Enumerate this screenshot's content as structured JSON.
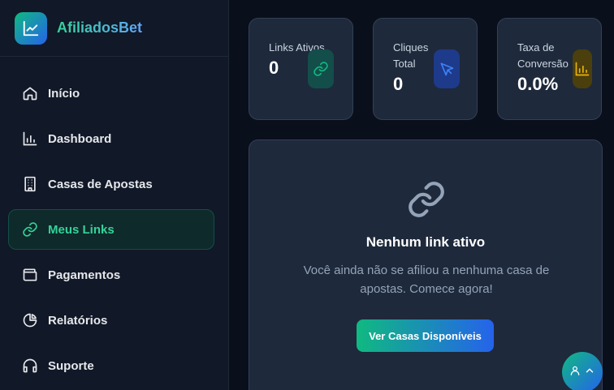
{
  "brand": {
    "name": "AfiliadosBet"
  },
  "sidebar": {
    "items": [
      {
        "label": "Início",
        "icon": "home-icon"
      },
      {
        "label": "Dashboard",
        "icon": "bar-chart-icon"
      },
      {
        "label": "Casas de Apostas",
        "icon": "building-icon"
      },
      {
        "label": "Meus Links",
        "icon": "link-icon",
        "active": true
      },
      {
        "label": "Pagamentos",
        "icon": "wallet-icon"
      },
      {
        "label": "Relatórios",
        "icon": "pie-chart-icon"
      },
      {
        "label": "Suporte",
        "icon": "headphones-icon"
      }
    ]
  },
  "stats": [
    {
      "label": "Links Ativos",
      "value": "0",
      "icon": "link-icon",
      "accent": "#10b981"
    },
    {
      "label": "Cliques Total",
      "value": "0",
      "icon": "cursor-icon",
      "accent": "#3b82f6"
    },
    {
      "label": "Taxa de Conversão",
      "value": "0.0%",
      "icon": "bar-chart-icon",
      "accent": "#eab308"
    }
  ],
  "empty_state": {
    "title": "Nenhum link ativo",
    "description": "Você ainda não se afiliou a nenhuma casa de apostas. Comece agora!",
    "button_label": "Ver Casas Disponíveis"
  },
  "colors": {
    "background": "#0a0f1c",
    "sidebar": "#111827",
    "card": "#1e293b",
    "accent_green": "#34d399",
    "accent_blue": "#2563eb"
  }
}
